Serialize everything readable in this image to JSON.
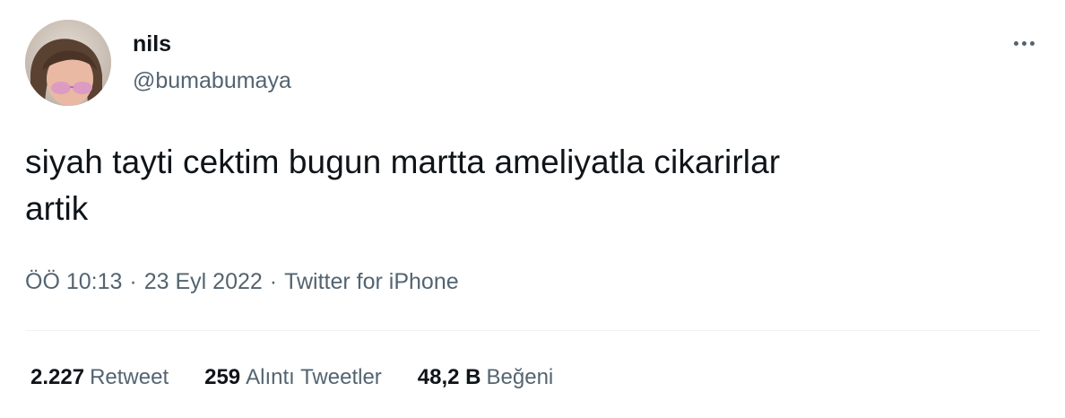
{
  "author": {
    "display_name": "nils",
    "handle": "@bumabumaya",
    "avatar_icon": "profile-photo"
  },
  "more_icon": "more-horizontal-icon",
  "tweet": {
    "text_line1": "siyah tayti cektim bugun martta ameliyatla cikarirlar",
    "text_line2": "artik"
  },
  "meta": {
    "time": "ÖÖ 10:13",
    "separator": "·",
    "date": "23 Eyl 2022",
    "source": "Twitter for iPhone"
  },
  "stats": [
    {
      "value": "2.227",
      "label": "Retweet"
    },
    {
      "value": "259",
      "label": "Alıntı Tweetler"
    },
    {
      "value": "48,2 B",
      "label": "Beğeni"
    }
  ],
  "colors": {
    "primary_text": "#0f1419",
    "secondary_text": "#536471",
    "divider": "#eff3f4"
  }
}
